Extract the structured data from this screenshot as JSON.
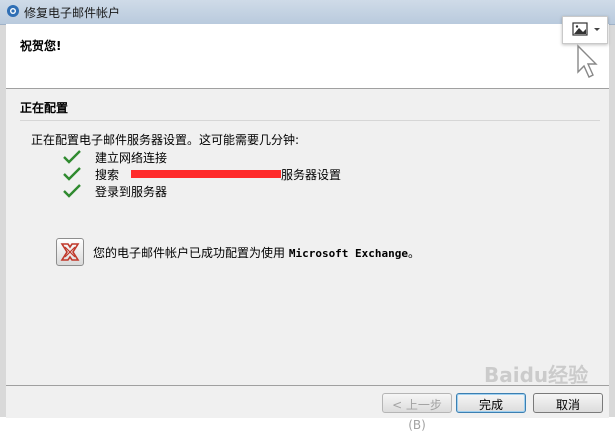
{
  "window": {
    "title": "修复电子邮件帐户"
  },
  "header": {
    "congrats": "祝贺您!"
  },
  "section": {
    "title": "正在配置",
    "description": "正在配置电子邮件服务器设置。这可能需要几分钟:"
  },
  "steps": [
    {
      "label": "建立网络连接",
      "status": "done"
    },
    {
      "prefix": "搜索",
      "suffix": "服务器设置",
      "status": "done"
    },
    {
      "label": "登录到服务器",
      "status": "done"
    }
  ],
  "result": {
    "message_prefix": "您的电子邮件帐户已成功配置为使用 ",
    "message_product": "Microsoft Exchange",
    "message_suffix": "。"
  },
  "buttons": {
    "back": "< 上一步(B)",
    "finish": "完成",
    "cancel": "取消"
  },
  "watermark": {
    "text": "Baidu经验"
  },
  "colors": {
    "check": "#2f8a2f",
    "redaction": "#ff2a2a",
    "accent": "#3c7fb1"
  }
}
